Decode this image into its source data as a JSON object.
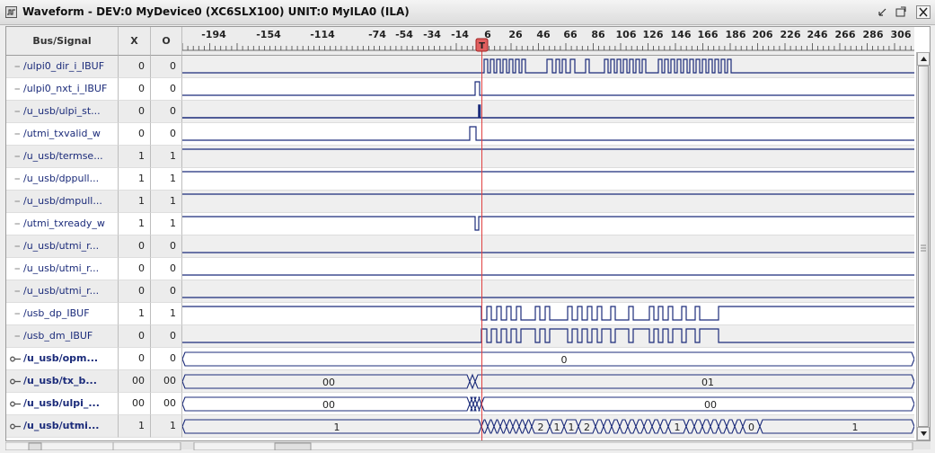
{
  "window": {
    "title": "Waveform - DEV:0 MyDevice0 (XC6SLX100) UNIT:0 MyILA0 (ILA)"
  },
  "columns": {
    "signal": "Bus/Signal",
    "x": "X",
    "o": "O"
  },
  "ruler": {
    "ticks": [
      "-194",
      "-154",
      "-114",
      "-74",
      "-54",
      "-34",
      "-14",
      "6",
      "26",
      "46",
      "66",
      "86",
      "106",
      "126",
      "146",
      "166",
      "186",
      "206",
      "226",
      "246",
      "266",
      "286",
      "306"
    ],
    "trigger_label": "T"
  },
  "signals": [
    {
      "name": "/ulpi0_dir_i_IBUF",
      "x": "0",
      "o": "0",
      "bus": false
    },
    {
      "name": "/ulpi0_nxt_i_IBUF",
      "x": "0",
      "o": "0",
      "bus": false
    },
    {
      "name": "/u_usb/ulpi_st...",
      "x": "0",
      "o": "0",
      "bus": false
    },
    {
      "name": "/utmi_txvalid_w",
      "x": "0",
      "o": "0",
      "bus": false
    },
    {
      "name": "/u_usb/termse...",
      "x": "1",
      "o": "1",
      "bus": false
    },
    {
      "name": "/u_usb/dppull...",
      "x": "1",
      "o": "1",
      "bus": false
    },
    {
      "name": "/u_usb/dmpull...",
      "x": "1",
      "o": "1",
      "bus": false
    },
    {
      "name": "/utmi_txready_w",
      "x": "1",
      "o": "1",
      "bus": false
    },
    {
      "name": "/u_usb/utmi_r...",
      "x": "0",
      "o": "0",
      "bus": false
    },
    {
      "name": "/u_usb/utmi_r...",
      "x": "0",
      "o": "0",
      "bus": false
    },
    {
      "name": "/u_usb/utmi_r...",
      "x": "0",
      "o": "0",
      "bus": false
    },
    {
      "name": "/usb_dp_IBUF",
      "x": "1",
      "o": "1",
      "bus": false
    },
    {
      "name": "/usb_dm_IBUF",
      "x": "0",
      "o": "0",
      "bus": false
    },
    {
      "name": "/u_usb/opm...",
      "x": "0",
      "o": "0",
      "bus": true
    },
    {
      "name": "/u_usb/tx_b...",
      "x": "00",
      "o": "00",
      "bus": true
    },
    {
      "name": "/u_usb/ulpi_...",
      "x": "00",
      "o": "00",
      "bus": true
    },
    {
      "name": "/u_usb/utmi...",
      "x": "1",
      "o": "1",
      "bus": true
    }
  ],
  "bus_values": {
    "opm": [
      "0"
    ],
    "tx_b": [
      "00",
      "01"
    ],
    "ulpi": [
      "00",
      "00"
    ],
    "utmi": [
      "1",
      "2",
      "1",
      "1",
      "2",
      "1",
      "0",
      "1"
    ]
  },
  "colors": {
    "wave": "#1b2b7a",
    "cursor": "#e04040",
    "trigger": "#e06060"
  }
}
